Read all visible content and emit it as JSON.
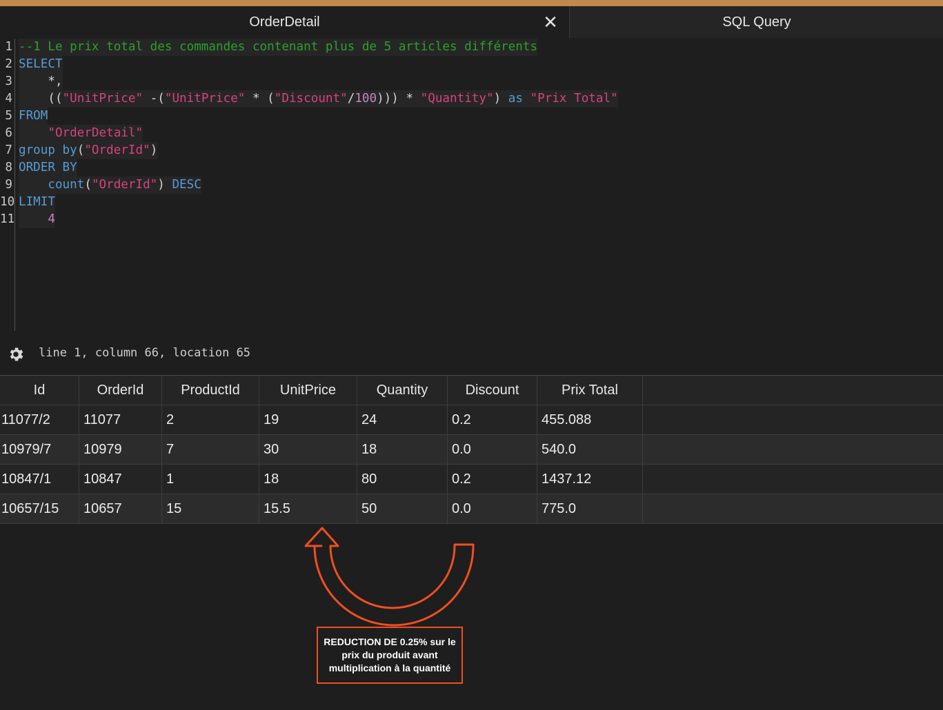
{
  "tabs": [
    {
      "label": "OrderDetail",
      "active": true
    },
    {
      "label": "SQL Query",
      "active": false
    }
  ],
  "close_glyph": "✕",
  "editor": {
    "lines": [
      {
        "num": "1",
        "tokens": [
          {
            "t": "--1 Le prix total des commandes contenant plus de 5 articles différents",
            "c": "c"
          }
        ]
      },
      {
        "num": "2",
        "tokens": [
          {
            "t": "SELECT",
            "c": "k"
          }
        ]
      },
      {
        "num": "3",
        "tokens": [
          {
            "t": "    *,",
            "c": "p"
          }
        ]
      },
      {
        "num": "4",
        "tokens": [
          {
            "t": "    ((",
            "c": "p"
          },
          {
            "t": "\"UnitPrice\"",
            "c": "s"
          },
          {
            "t": " -(",
            "c": "p"
          },
          {
            "t": "\"UnitPrice\"",
            "c": "s"
          },
          {
            "t": " * (",
            "c": "p"
          },
          {
            "t": "\"Discount\"",
            "c": "s"
          },
          {
            "t": "/",
            "c": "p"
          },
          {
            "t": "100",
            "c": "n"
          },
          {
            "t": "))) * ",
            "c": "p"
          },
          {
            "t": "\"Quantity\"",
            "c": "s"
          },
          {
            "t": ") ",
            "c": "p"
          },
          {
            "t": "as",
            "c": "k"
          },
          {
            "t": " ",
            "c": "p"
          },
          {
            "t": "\"Prix Total\"",
            "c": "s"
          }
        ]
      },
      {
        "num": "5",
        "tokens": [
          {
            "t": "FROM",
            "c": "k"
          }
        ]
      },
      {
        "num": "6",
        "tokens": [
          {
            "t": "    ",
            "c": "p"
          },
          {
            "t": "\"OrderDetail\"",
            "c": "s"
          }
        ]
      },
      {
        "num": "7",
        "tokens": [
          {
            "t": "group by",
            "c": "k"
          },
          {
            "t": "(",
            "c": "p"
          },
          {
            "t": "\"OrderId\"",
            "c": "s"
          },
          {
            "t": ")",
            "c": "p"
          }
        ]
      },
      {
        "num": "8",
        "tokens": [
          {
            "t": "ORDER BY",
            "c": "k"
          }
        ]
      },
      {
        "num": "9",
        "tokens": [
          {
            "t": "    ",
            "c": "p"
          },
          {
            "t": "count",
            "c": "k"
          },
          {
            "t": "(",
            "c": "p"
          },
          {
            "t": "\"OrderId\"",
            "c": "s"
          },
          {
            "t": ") ",
            "c": "p"
          },
          {
            "t": "DESC",
            "c": "k"
          }
        ]
      },
      {
        "num": "10",
        "tokens": [
          {
            "t": "LIMIT",
            "c": "k"
          }
        ]
      },
      {
        "num": "11",
        "tokens": [
          {
            "t": "    ",
            "c": "p"
          },
          {
            "t": "4",
            "c": "n"
          }
        ]
      }
    ]
  },
  "status": {
    "text": "line 1, column 66, location 65",
    "icon": "gear-icon"
  },
  "results": {
    "columns": [
      "Id",
      "OrderId",
      "ProductId",
      "UnitPrice",
      "Quantity",
      "Discount",
      "Prix Total"
    ],
    "rows": [
      [
        "11077/2",
        "11077",
        "2",
        "19",
        "24",
        "0.2",
        "455.088"
      ],
      [
        "10979/7",
        "10979",
        "7",
        "30",
        "18",
        "0.0",
        "540.0"
      ],
      [
        "10847/1",
        "10847",
        "1",
        "18",
        "80",
        "0.2",
        "1437.12"
      ],
      [
        "10657/15",
        "10657",
        "15",
        "15.5",
        "50",
        "0.0",
        "775.0"
      ]
    ]
  },
  "annotation": {
    "text": "REDUCTION DE 0.25% sur le prix du produit avant multiplication à la quantité",
    "color": "#f04e23",
    "icon": "curved-arrow-icon"
  },
  "colors": {
    "accent_strip": "#c08a4e",
    "keyword": "#569cd6",
    "string": "#d7427d",
    "comment": "#2ca02c",
    "number": "#c586c0"
  }
}
